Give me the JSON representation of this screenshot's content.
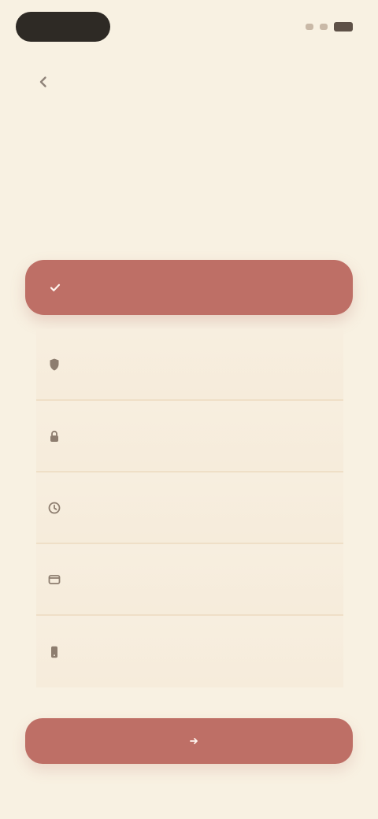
{
  "status_bar": {
    "time": "",
    "signal_icon": "signal-icon",
    "wifi_icon": "wifi-icon",
    "battery_icon": "battery-icon"
  },
  "header": {
    "back_icon": "chevron-left-icon",
    "title": ""
  },
  "intro": {
    "title": "",
    "subtitle": ""
  },
  "primary_option": {
    "label": "",
    "icon": "check-icon"
  },
  "options": [
    {
      "label": "",
      "icon": "shield-icon"
    },
    {
      "label": "",
      "icon": "lock-icon"
    },
    {
      "label": "",
      "icon": "clock-icon"
    },
    {
      "label": "",
      "icon": "card-icon"
    },
    {
      "label": "",
      "icon": "phone-icon"
    }
  ],
  "footer_button": {
    "label": "",
    "icon": "arrow-right-icon"
  },
  "colors": {
    "background": "#f8f1e2",
    "accent": "#be6f66",
    "divider": "#efdfc7"
  }
}
